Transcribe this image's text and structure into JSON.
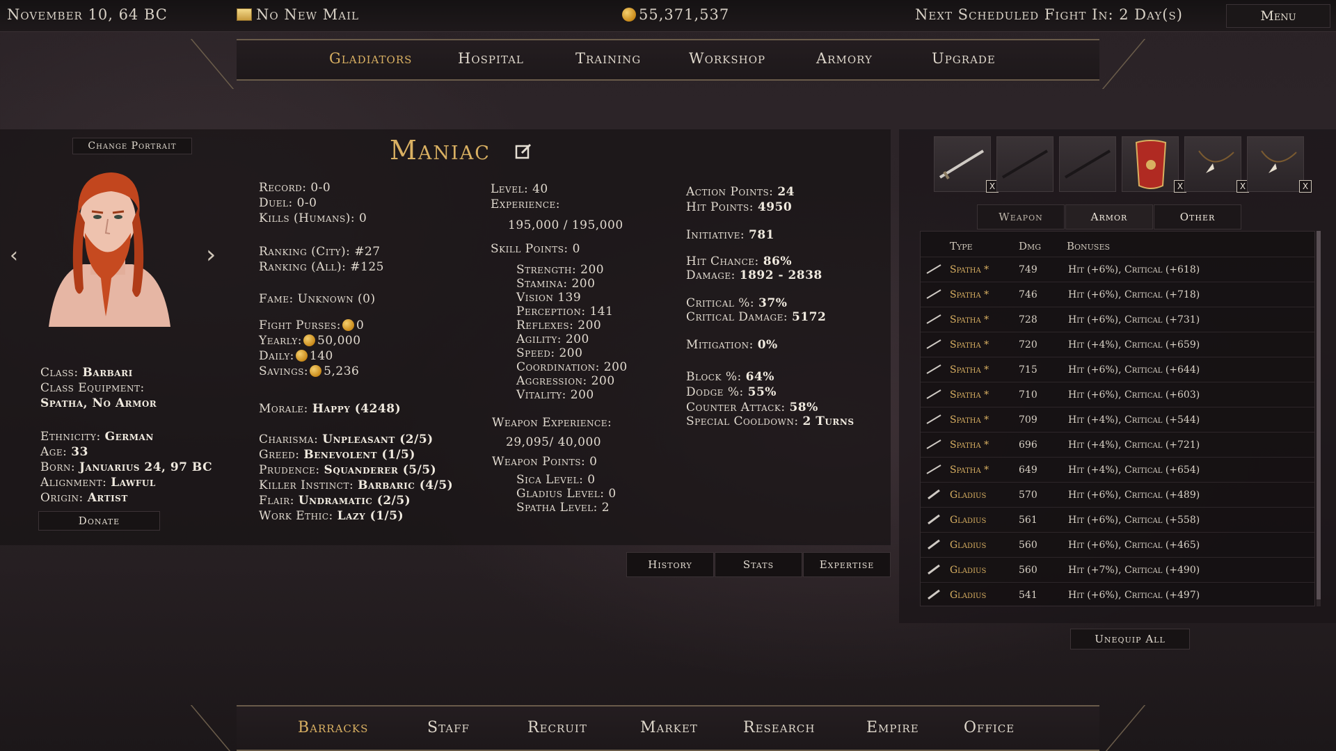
{
  "topbar": {
    "date": "November 10, 64 BC",
    "mail": "No New Mail",
    "gold": "55,371,537",
    "next_fight": "Next Scheduled Fight In: 2 Day(s)",
    "menu": "Menu"
  },
  "top_tabs": [
    "Gladiators",
    "Hospital",
    "Training",
    "Workshop",
    "Armory",
    "Upgrade"
  ],
  "bottom_tabs": [
    "Barracks",
    "Staff",
    "Recruit",
    "Market",
    "Research",
    "Empire",
    "Office"
  ],
  "portrait": {
    "change_label": "Change Portrait",
    "donate_label": "Donate"
  },
  "gladiator": {
    "name": "Maniac",
    "class_label": "Class:",
    "class": "Barbari",
    "equipment_label": "Class Equipment:",
    "equipment": "Spatha, No Armor",
    "ethnicity_label": "Ethnicity:",
    "ethnicity": "German",
    "age_label": "Age:",
    "age": "33",
    "born_label": "Born:",
    "born": "Januarius 24, 97 BC",
    "alignment_label": "Alignment:",
    "alignment": "Lawful",
    "origin_label": "Origin:",
    "origin": "Artist"
  },
  "record": {
    "record": "Record: 0-0",
    "duel": "Duel: 0-0",
    "kills": "Kills (Humans): 0",
    "rank_city": "Ranking (City): #27",
    "rank_all": "Ranking (All): #125",
    "fame": "Fame: Unknown (0)",
    "fight_purses_label": "Fight Purses:",
    "fight_purses": "0",
    "yearly_label": "Yearly:",
    "yearly": "50,000",
    "daily_label": "Daily:",
    "daily": "140",
    "savings_label": "Savings:",
    "savings": "5,236",
    "morale_label": "Morale:",
    "morale": "Happy (4248)",
    "traits": [
      {
        "label": "Charisma:",
        "value": "Unpleasant (2/5)"
      },
      {
        "label": "Greed:",
        "value": "Benevolent (1/5)"
      },
      {
        "label": "Prudence:",
        "value": "Squanderer (5/5)"
      },
      {
        "label": "Killer Instinct:",
        "value": "Barbaric (4/5)"
      },
      {
        "label": "Flair:",
        "value": "Undramatic (2/5)"
      },
      {
        "label": "Work Ethic:",
        "value": "Lazy (1/5)"
      }
    ]
  },
  "skills": {
    "level": "Level: 40",
    "experience_label": "Experience:",
    "experience": "195,000 / 195,000",
    "skill_points": "Skill Points: 0",
    "attributes": [
      "Strength: 200",
      "Stamina: 200",
      "Vision 139",
      "Perception: 141",
      "Reflexes: 200",
      "Agility: 200",
      "Speed: 200",
      "Coordination: 200",
      "Aggression: 200",
      "Vitality: 200"
    ],
    "weapon_experience_label": "Weapon Experience:",
    "weapon_experience": "29,095/ 40,000",
    "weapon_points": "Weapon Points: 0",
    "weapon_levels": [
      "Sica Level: 0",
      "Gladius Level: 0",
      "Spatha Level: 2"
    ]
  },
  "combat": {
    "action_points_label": "Action Points:",
    "action_points": "24",
    "hit_points_label": "Hit Points:",
    "hit_points": "4950",
    "initiative_label": "Initiative:",
    "initiative": "781",
    "hit_chance_label": "Hit Chance:",
    "hit_chance": "86%",
    "damage_label": "Damage:",
    "damage": "1892 - 2838",
    "critical_label": "Critical %:",
    "critical": "37%",
    "critical_damage_label": "Critical Damage:",
    "critical_damage": "5172",
    "mitigation_label": "Mitigation:",
    "mitigation": "0%",
    "block_label": "Block %:",
    "block": "64%",
    "dodge_label": "Dodge %:",
    "dodge": "55%",
    "counter_label": "Counter Attack:",
    "counter": "58%",
    "cooldown_label": "Special Cooldown:",
    "cooldown": "2 Turns"
  },
  "stat_tabs": [
    "History",
    "Stats",
    "Expertise"
  ],
  "inventory": {
    "sub_tabs": [
      "Weapon",
      "Armor",
      "Other"
    ],
    "headers": {
      "type": "Type",
      "dmg": "Dmg",
      "bonuses": "Bonuses"
    },
    "rows": [
      {
        "type": "Spatha *",
        "dmg": "749",
        "bonuses": "Hit (+6%), Critical (+618)"
      },
      {
        "type": "Spatha *",
        "dmg": "746",
        "bonuses": "Hit (+6%), Critical (+718)"
      },
      {
        "type": "Spatha *",
        "dmg": "728",
        "bonuses": "Hit (+6%), Critical (+731)"
      },
      {
        "type": "Spatha *",
        "dmg": "720",
        "bonuses": "Hit (+4%), Critical (+659)"
      },
      {
        "type": "Spatha *",
        "dmg": "715",
        "bonuses": "Hit (+6%), Critical (+644)"
      },
      {
        "type": "Spatha *",
        "dmg": "710",
        "bonuses": "Hit (+6%), Critical (+603)"
      },
      {
        "type": "Spatha *",
        "dmg": "709",
        "bonuses": "Hit (+4%), Critical (+544)"
      },
      {
        "type": "Spatha *",
        "dmg": "696",
        "bonuses": "Hit (+4%), Critical (+721)"
      },
      {
        "type": "Spatha *",
        "dmg": "649",
        "bonuses": "Hit (+4%), Critical (+654)"
      },
      {
        "type": "Gladius",
        "dmg": "570",
        "bonuses": "Hit (+6%), Critical (+489)"
      },
      {
        "type": "Gladius",
        "dmg": "561",
        "bonuses": "Hit (+6%), Critical (+558)"
      },
      {
        "type": "Gladius",
        "dmg": "560",
        "bonuses": "Hit (+6%), Critical (+465)"
      },
      {
        "type": "Gladius",
        "dmg": "560",
        "bonuses": "Hit (+7%), Critical (+490)"
      },
      {
        "type": "Gladius",
        "dmg": "541",
        "bonuses": "Hit (+6%), Critical (+497)"
      }
    ],
    "unequip_all": "Unequip All",
    "slot_close": "X"
  },
  "colors": {
    "accent_gold": "#d9b062",
    "hair": "#c2461e",
    "shield": "#b02a22"
  }
}
